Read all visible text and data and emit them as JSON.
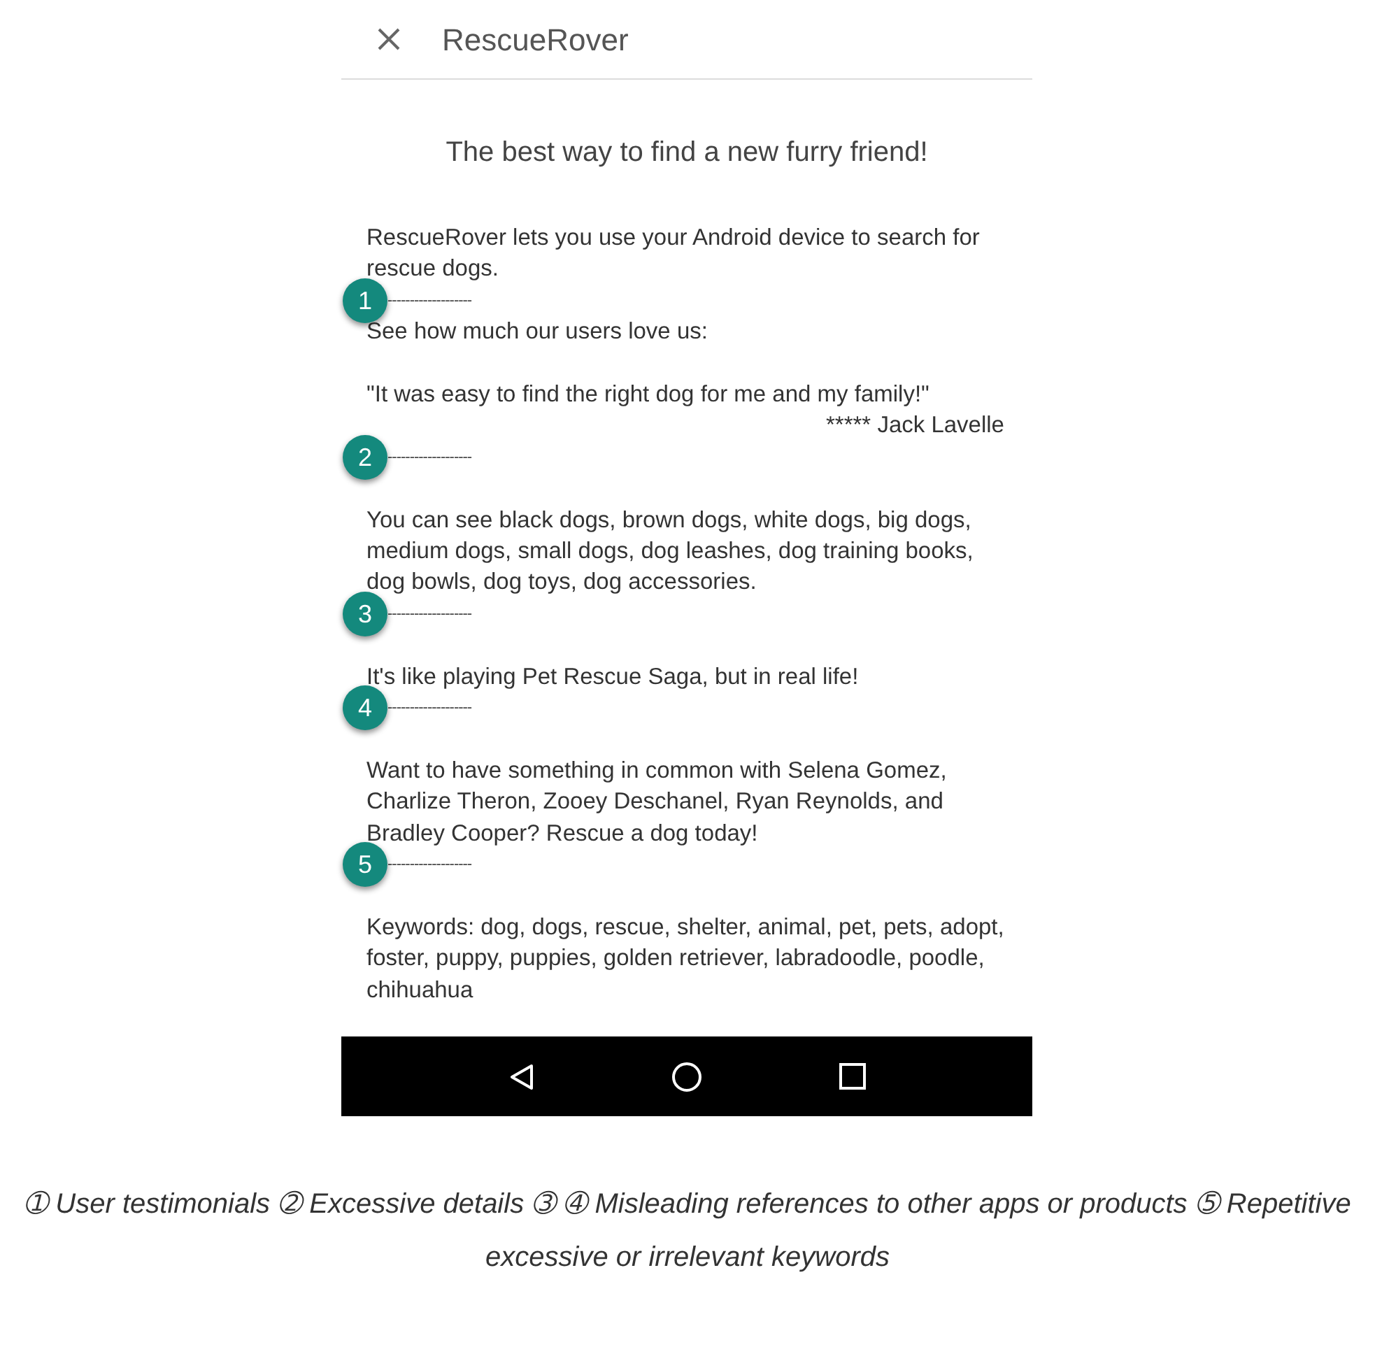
{
  "app_bar": {
    "title": "RescueRover"
  },
  "tagline": "The best way to find a new furry friend!",
  "description": [
    {
      "kind": "text",
      "text": "RescueRover lets you use your Android device to search for rescue dogs."
    },
    {
      "kind": "divider",
      "badge": "1",
      "text": "-------------------"
    },
    {
      "kind": "text",
      "text": "See how much our users love us:"
    },
    {
      "kind": "blank"
    },
    {
      "kind": "text",
      "text": "\"It was easy to find the right dog for me and my family!\""
    },
    {
      "kind": "attribution",
      "text": "***** Jack Lavelle"
    },
    {
      "kind": "divider",
      "badge": "2",
      "text": "-------------------"
    },
    {
      "kind": "blank"
    },
    {
      "kind": "text",
      "text": "You can see black dogs, brown dogs, white dogs, big dogs, medium dogs, small dogs, dog leashes, dog training books, dog bowls, dog toys, dog accessories."
    },
    {
      "kind": "divider",
      "badge": "3",
      "text": "-------------------"
    },
    {
      "kind": "blank"
    },
    {
      "kind": "text",
      "text": "It's like playing Pet Rescue Saga, but in real life!"
    },
    {
      "kind": "divider",
      "badge": "4",
      "text": "-------------------"
    },
    {
      "kind": "blank"
    },
    {
      "kind": "text",
      "text": "Want to have something in common with Selena Gomez, Charlize Theron, Zooey Deschanel, Ryan Reynolds, and Bradley Cooper? Rescue a dog today!"
    },
    {
      "kind": "divider",
      "badge": "5",
      "text": "-------------------"
    },
    {
      "kind": "blank"
    },
    {
      "kind": "text",
      "text": "Keywords: dog, dogs, rescue, shelter, animal, pet, pets, adopt, foster, puppy, puppies, golden retriever, labradoodle, poodle, chihuahua"
    }
  ],
  "caption": "➀ User testimonials ➁ Excessive details ➂ ➃ Misleading references to other apps or products ➄ Repetitive excessive or irrelevant keywords"
}
